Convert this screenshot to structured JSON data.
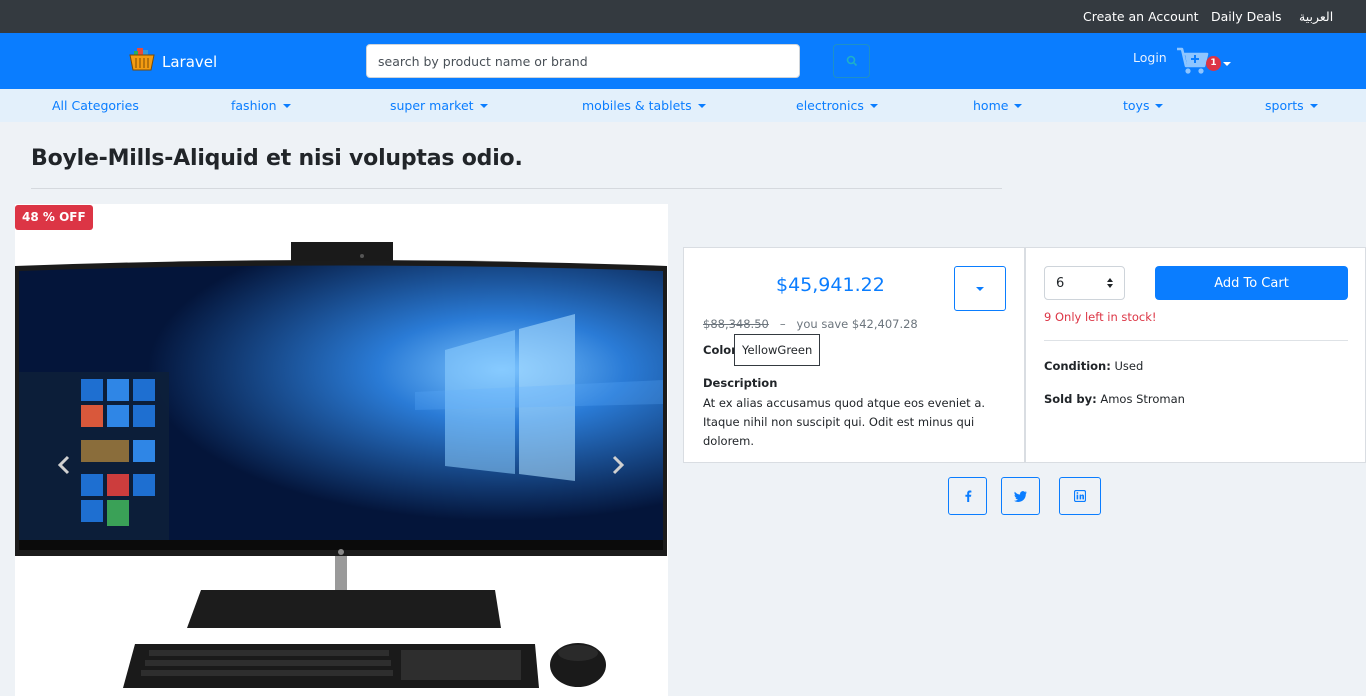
{
  "topbar": {
    "create_account": "Create an Account",
    "daily_deals": "Daily Deals",
    "language": "العربية"
  },
  "header": {
    "brand": "Laravel",
    "search_placeholder": "search by product name or brand",
    "login": "Login",
    "cart_count": "1"
  },
  "categories": [
    {
      "label": "All Categories"
    },
    {
      "label": "fashion"
    },
    {
      "label": "super market"
    },
    {
      "label": "mobiles & tablets"
    },
    {
      "label": "electronics"
    },
    {
      "label": "home"
    },
    {
      "label": "toys"
    },
    {
      "label": "sports"
    }
  ],
  "product": {
    "title": "Boyle-Mills-Aliquid et nisi voluptas odio.",
    "discount_badge": "48 % OFF",
    "price": "$45,941.22",
    "old_price": "$88,348.50",
    "separator": "–",
    "you_save": "you save $42,407.28",
    "color_label": "Color:",
    "color_value": "YellowGreen",
    "description_label": "Description",
    "description": "At ex alias accusamus quod atque eos eveniet a. Itaque nihil non suscipit qui. Odit est minus qui dolorem.",
    "quantity": "6",
    "add_to_cart": "Add To Cart",
    "stock": "9 Only left in stock!",
    "condition_label": "Condition:",
    "condition_value": "Used",
    "sold_by_label": "Sold by:",
    "sold_by_value": "Amos Stroman"
  },
  "social": [
    "facebook-icon",
    "twitter-icon",
    "linkedin-icon"
  ],
  "colors": {
    "primary": "#0a7dff",
    "topbar": "#343a40",
    "danger": "#dc3545",
    "page_bg": "#eef2f6"
  }
}
